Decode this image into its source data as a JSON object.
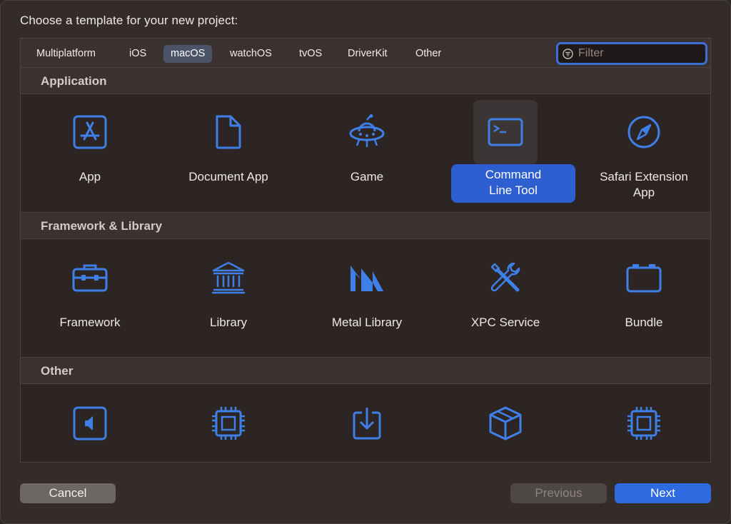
{
  "dialog": {
    "heading": "Choose a template for your new project:"
  },
  "tabs": [
    {
      "label": "Multiplatform"
    },
    {
      "label": "iOS"
    },
    {
      "label": "macOS",
      "active": true
    },
    {
      "label": "watchOS"
    },
    {
      "label": "tvOS"
    },
    {
      "label": "DriverKit"
    },
    {
      "label": "Other"
    }
  ],
  "filter": {
    "placeholder": "Filter",
    "value": "",
    "icon": "filter-icon"
  },
  "sections": [
    {
      "title": "Application",
      "items": [
        {
          "label": "App",
          "icon": "app-store-icon"
        },
        {
          "label": "Document App",
          "icon": "document-icon"
        },
        {
          "label": "Game",
          "icon": "ufo-icon"
        },
        {
          "label": "Command Line Tool",
          "label_line1": "Command",
          "label_line2": "Line Tool",
          "icon": "terminal-icon",
          "selected": true
        },
        {
          "label": "Safari Extension App",
          "label_line1": "Safari Extension",
          "label_line2": "App",
          "icon": "compass-icon"
        }
      ]
    },
    {
      "title": "Framework & Library",
      "items": [
        {
          "label": "Framework",
          "icon": "toolbox-icon"
        },
        {
          "label": "Library",
          "icon": "building-columns-icon"
        },
        {
          "label": "Metal Library",
          "icon": "metal-icon"
        },
        {
          "label": "XPC Service",
          "icon": "wrench-screwdriver-icon"
        },
        {
          "label": "Bundle",
          "icon": "bundle-icon"
        }
      ]
    },
    {
      "title": "Other",
      "items": [
        {
          "label": "",
          "icon": "speaker-icon"
        },
        {
          "label": "",
          "icon": "chip-icon"
        },
        {
          "label": "",
          "icon": "download-tray-icon"
        },
        {
          "label": "",
          "icon": "package-icon"
        },
        {
          "label": "",
          "icon": "chip-icon"
        }
      ]
    }
  ],
  "buttons": {
    "cancel": "Cancel",
    "previous": "Previous",
    "next": "Next"
  },
  "colors": {
    "accent": "#2f6ae0",
    "icon": "#3f7fe8",
    "selection": "#2d5fd0",
    "background": "#2c2523"
  }
}
